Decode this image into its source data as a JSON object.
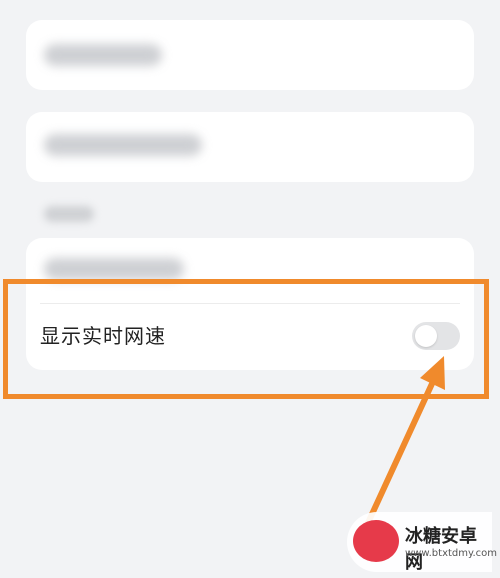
{
  "settings": {
    "network_speed_label": "显示实时网速",
    "network_speed_enabled": false
  },
  "annotation": {
    "accent_color": "#f08a2c"
  },
  "watermark": {
    "title": "冰糖安卓网",
    "url": "www.btxtdmy.com"
  },
  "colors": {
    "background": "#f2f3f5",
    "card": "#ffffff",
    "toggle_off": "#e3e4e6"
  }
}
